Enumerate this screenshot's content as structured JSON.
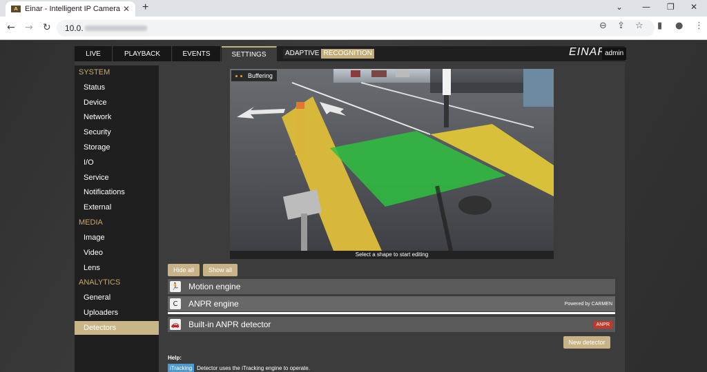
{
  "browser": {
    "tab_title": "Einar - Intelligent IP Camera",
    "favicon_text": "A",
    "new_tab": "+",
    "url": "10.0.",
    "icons": {
      "back": "arrow-left-icon",
      "forward": "arrow-right-icon",
      "reload": "reload-icon",
      "zoom": "magnifier-icon",
      "share": "share-icon",
      "bookmark": "star-icon",
      "sidepanel": "sidepanel-icon",
      "profile": "avatar-icon",
      "menu": "kebab-menu-icon"
    }
  },
  "topnav": {
    "tabs": [
      "LIVE",
      "PLAYBACK",
      "EVENTS",
      "SETTINGS"
    ],
    "active_tab": "SETTINGS",
    "adaptive_a": "ADAPTIVE",
    "adaptive_b": "RECOGNITION",
    "brand": "EINAR",
    "user": "admin"
  },
  "sidebar": {
    "system_header": "SYSTEM",
    "system_items": [
      "Status",
      "Device",
      "Network",
      "Security",
      "Storage",
      "I/O",
      "Service",
      "Notifications",
      "External"
    ],
    "media_header": "MEDIA",
    "media_items": [
      "Image",
      "Video",
      "Lens"
    ],
    "analytics_header": "ANALYTICS",
    "analytics_items": [
      "General",
      "Uploaders",
      "Detectors"
    ],
    "active_item": "Detectors"
  },
  "video": {
    "status": "Buffering",
    "caption": "Select a shape to start editing"
  },
  "controls": {
    "hide_all": "Hide all",
    "show_all": "Show all",
    "new_detector": "New detector"
  },
  "engines": {
    "motion": "Motion engine",
    "anpr": "ANPR engine",
    "anpr_powered": "Powered by CARMEN",
    "builtin": "Built-in ANPR detector",
    "builtin_badge": "ANPR"
  },
  "help": {
    "title": "Help:",
    "badge": "iTracking",
    "text": "Detector uses the iTracking engine to operate."
  },
  "colors": {
    "accent": "#c8b386",
    "sidebar_header": "#c9a86a",
    "zone": "#2fbf3f",
    "badge_red": "#c0392b",
    "help_badge": "#4a9bd0"
  }
}
